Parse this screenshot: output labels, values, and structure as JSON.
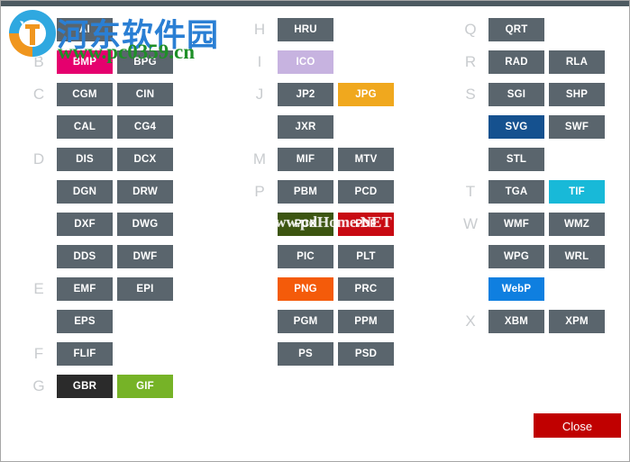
{
  "window": {
    "accent_bar_color": "#4d5a61",
    "background": "#ffffff"
  },
  "palette": {
    "default_button": "#5a656d",
    "bmp": "#e5006e",
    "gbr": "#2b2b2b",
    "gif": "#76b327",
    "ico": "#c7b3e0",
    "jpg": "#f0a81e",
    "pcx": "#3c5510",
    "pdf": "#c80a12",
    "png": "#f45b0a",
    "svg": "#15518f",
    "tif": "#18b9d8",
    "webp": "#0f7fe0",
    "close": "#c00000",
    "group_letter": "#c9cccf"
  },
  "columns": [
    {
      "name": "column-1",
      "groups": [
        {
          "letter": "A",
          "rows": [
            [
              {
                "label": "AI",
                "color": "default"
              }
            ]
          ]
        },
        {
          "letter": "B",
          "rows": [
            [
              {
                "label": "BMP",
                "color": "bmp"
              },
              {
                "label": "BPG",
                "color": "default"
              }
            ]
          ]
        },
        {
          "letter": "C",
          "rows": [
            [
              {
                "label": "CGM",
                "color": "default"
              },
              {
                "label": "CIN",
                "color": "default"
              }
            ],
            [
              {
                "label": "CAL",
                "color": "default"
              },
              {
                "label": "CG4",
                "color": "default"
              }
            ]
          ]
        },
        {
          "letter": "D",
          "rows": [
            [
              {
                "label": "DIS",
                "color": "default"
              },
              {
                "label": "DCX",
                "color": "default"
              }
            ],
            [
              {
                "label": "DGN",
                "color": "default"
              },
              {
                "label": "DRW",
                "color": "default"
              }
            ],
            [
              {
                "label": "DXF",
                "color": "default"
              },
              {
                "label": "DWG",
                "color": "default"
              }
            ],
            [
              {
                "label": "DDS",
                "color": "default"
              },
              {
                "label": "DWF",
                "color": "default"
              }
            ]
          ]
        },
        {
          "letter": "E",
          "rows": [
            [
              {
                "label": "EMF",
                "color": "default"
              },
              {
                "label": "EPI",
                "color": "default"
              }
            ],
            [
              {
                "label": "EPS",
                "color": "default"
              }
            ]
          ]
        },
        {
          "letter": "F",
          "rows": [
            [
              {
                "label": "FLIF",
                "color": "default"
              }
            ]
          ]
        },
        {
          "letter": "G",
          "rows": [
            [
              {
                "label": "GBR",
                "color": "gbr"
              },
              {
                "label": "GIF",
                "color": "gif"
              }
            ]
          ]
        }
      ]
    },
    {
      "name": "column-2",
      "groups": [
        {
          "letter": "H",
          "rows": [
            [
              {
                "label": "HRU",
                "color": "default"
              }
            ]
          ]
        },
        {
          "letter": "I",
          "rows": [
            [
              {
                "label": "ICO",
                "color": "ico"
              }
            ]
          ]
        },
        {
          "letter": "J",
          "rows": [
            [
              {
                "label": "JP2",
                "color": "default"
              },
              {
                "label": "JPG",
                "color": "jpg"
              }
            ],
            [
              {
                "label": "JXR",
                "color": "default"
              }
            ]
          ]
        },
        {
          "letter": "M",
          "rows": [
            [
              {
                "label": "MIF",
                "color": "default"
              },
              {
                "label": "MTV",
                "color": "default"
              }
            ]
          ]
        },
        {
          "letter": "P",
          "rows": [
            [
              {
                "label": "PBM",
                "color": "default"
              },
              {
                "label": "PCD",
                "color": "default"
              }
            ],
            [
              {
                "label": "PCX",
                "color": "pcx"
              },
              {
                "label": "PDF",
                "color": "pdf"
              }
            ],
            [
              {
                "label": "PIC",
                "color": "default"
              },
              {
                "label": "PLT",
                "color": "default"
              }
            ],
            [
              {
                "label": "PNG",
                "color": "png"
              },
              {
                "label": "PRC",
                "color": "default"
              }
            ],
            [
              {
                "label": "PGM",
                "color": "default"
              },
              {
                "label": "PPM",
                "color": "default"
              }
            ],
            [
              {
                "label": "PS",
                "color": "default"
              },
              {
                "label": "PSD",
                "color": "default"
              }
            ]
          ]
        }
      ]
    },
    {
      "name": "column-3",
      "groups": [
        {
          "letter": "Q",
          "rows": [
            [
              {
                "label": "QRT",
                "color": "default"
              }
            ]
          ]
        },
        {
          "letter": "R",
          "rows": [
            [
              {
                "label": "RAD",
                "color": "default"
              },
              {
                "label": "RLA",
                "color": "default"
              }
            ]
          ]
        },
        {
          "letter": "S",
          "rows": [
            [
              {
                "label": "SGI",
                "color": "default"
              },
              {
                "label": "SHP",
                "color": "default"
              }
            ],
            [
              {
                "label": "SVG",
                "color": "svg"
              },
              {
                "label": "SWF",
                "color": "default"
              }
            ],
            [
              {
                "label": "STL",
                "color": "default"
              }
            ]
          ]
        },
        {
          "letter": "T",
          "rows": [
            [
              {
                "label": "TGA",
                "color": "default"
              },
              {
                "label": "TIF",
                "color": "tif"
              }
            ]
          ]
        },
        {
          "letter": "W",
          "rows": [
            [
              {
                "label": "WMF",
                "color": "default"
              },
              {
                "label": "WMZ",
                "color": "default"
              }
            ],
            [
              {
                "label": "WPG",
                "color": "default"
              },
              {
                "label": "WRL",
                "color": "default"
              }
            ],
            [
              {
                "label": "WebP",
                "color": "webp"
              }
            ]
          ]
        },
        {
          "letter": "X",
          "rows": [
            [
              {
                "label": "XBM",
                "color": "default"
              },
              {
                "label": "XPM",
                "color": "default"
              }
            ]
          ]
        }
      ]
    }
  ],
  "footer": {
    "close_label": "Close"
  },
  "watermark": {
    "site_name_cn": "河东软件园",
    "site_url": "www.pc0359.cn",
    "center_text": "www.pdHome.NET"
  }
}
